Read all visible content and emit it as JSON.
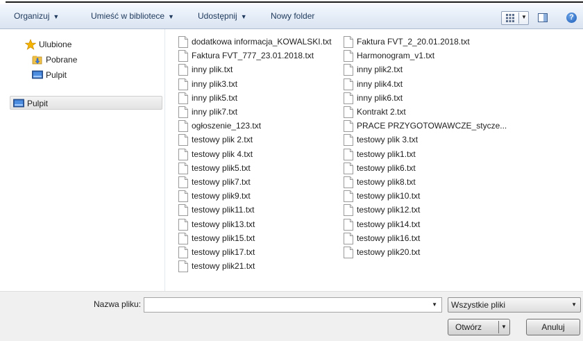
{
  "toolbar": {
    "organize": "Organizuj",
    "include_in_library": "Umieść w bibliotece",
    "share": "Udostępnij",
    "new_folder": "Nowy folder",
    "help": "?"
  },
  "nav": {
    "favorites": "Ulubione",
    "downloads": "Pobrane",
    "desktop_fav": "Pulpit",
    "desktop": "Pulpit"
  },
  "files": {
    "left": [
      "dodatkowa informacja_KOWALSKI.txt",
      "Faktura FVT_777_23.01.2018.txt",
      "inny plik.txt",
      "inny plik3.txt",
      "inny plik5.txt",
      "inny plik7.txt",
      "ogłoszenie_123.txt",
      "testowy plik 2.txt",
      "testowy plik 4.txt",
      "testowy plik5.txt",
      "testowy plik7.txt",
      "testowy plik9.txt",
      "testowy plik11.txt",
      "testowy plik13.txt",
      "testowy plik15.txt",
      "testowy plik17.txt",
      "testowy plik21.txt"
    ],
    "right": [
      "Faktura FVT_2_20.01.2018.txt",
      "Harmonogram_v1.txt",
      "inny plik2.txt",
      "inny plik4.txt",
      "inny plik6.txt",
      "Kontrakt 2.txt",
      "PRACE PRZYGOTOWAWCZE_stycze...",
      "testowy plik 3.txt",
      "testowy plik1.txt",
      "testowy plik6.txt",
      "testowy plik8.txt",
      "testowy plik10.txt",
      "testowy plik12.txt",
      "testowy plik14.txt",
      "testowy plik16.txt",
      "testowy plik20.txt"
    ]
  },
  "bottom": {
    "filename_label": "Nazwa pliku:",
    "filename_value": "",
    "filetype": "Wszystkie pliki",
    "open": "Otwórz",
    "cancel": "Anuluj"
  },
  "colors": {
    "toolbar_text": "#1e395b",
    "folder_yellow": "#f0c24a",
    "star": "#f5b400"
  }
}
